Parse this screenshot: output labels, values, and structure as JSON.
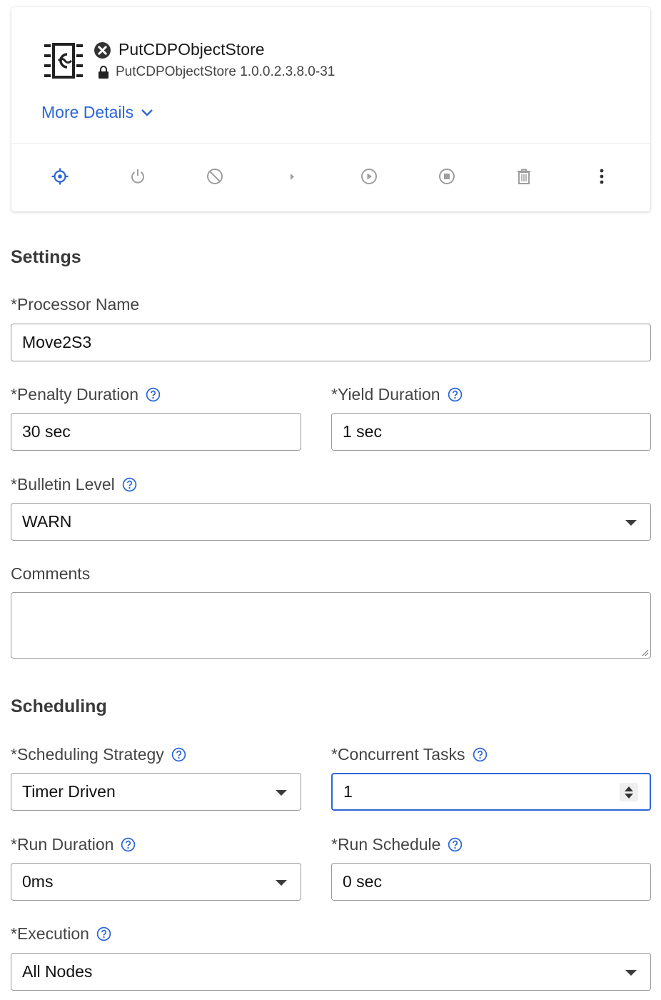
{
  "processor": {
    "title": "PutCDPObjectStore",
    "version": "PutCDPObjectStore 1.0.0.2.3.8.0-31",
    "more_details": "More Details"
  },
  "toolbar": {
    "icons": [
      "locate-icon",
      "power-icon",
      "disable-icon",
      "run-once-icon",
      "start-icon",
      "stop-icon",
      "delete-icon",
      "more-options-icon"
    ]
  },
  "settings": {
    "title": "Settings",
    "processor_name": {
      "label": "*Processor Name",
      "value": "Move2S3"
    },
    "penalty_duration": {
      "label": "*Penalty Duration",
      "value": "30 sec"
    },
    "yield_duration": {
      "label": "*Yield Duration",
      "value": "1 sec"
    },
    "bulletin_level": {
      "label": "*Bulletin Level",
      "value": "WARN"
    },
    "comments": {
      "label": "Comments",
      "value": ""
    }
  },
  "scheduling": {
    "title": "Scheduling",
    "strategy": {
      "label": "*Scheduling Strategy",
      "value": "Timer Driven"
    },
    "concurrent_tasks": {
      "label": "*Concurrent Tasks",
      "value": "1"
    },
    "run_duration": {
      "label": "*Run Duration",
      "value": "0ms"
    },
    "run_schedule": {
      "label": "*Run Schedule",
      "value": "0 sec"
    },
    "execution": {
      "label": "*Execution",
      "value": "All Nodes"
    }
  },
  "colors": {
    "accent": "#2c66d8",
    "icon_gray": "#9e9e9e",
    "text": "#444444"
  }
}
